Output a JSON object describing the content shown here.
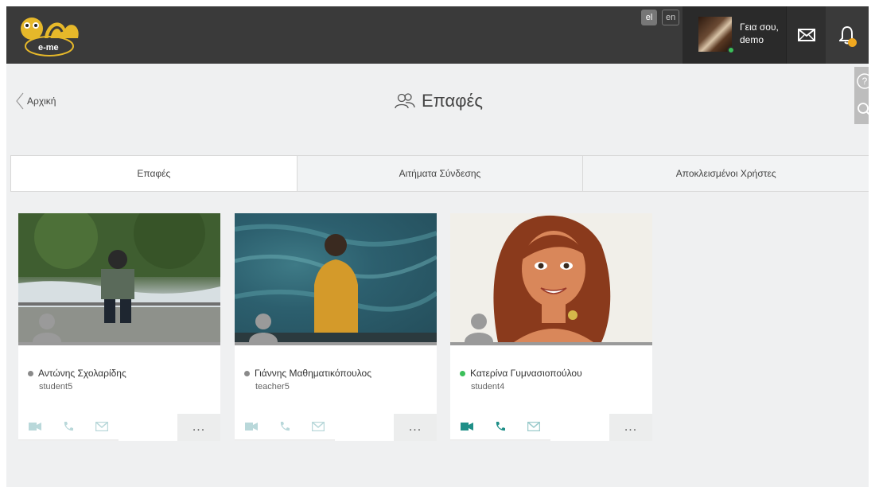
{
  "app": {
    "logo_text": "e-me",
    "languages": [
      {
        "code": "el",
        "active": true
      },
      {
        "code": "en",
        "active": false
      }
    ],
    "user": {
      "greeting": "Γεια σου,",
      "name": "demo",
      "online": true
    },
    "notifications": {
      "badge_color": "#f0a820"
    },
    "colors": {
      "accent_teal": "#2a9d8f",
      "online": "#3bbf5a",
      "offline": "#8a8a8a",
      "topbar": "#3a3a3a"
    }
  },
  "header": {
    "back_label": "Αρχική",
    "title": "Επαφές",
    "title_icon": "contacts-icon"
  },
  "side_tools": [
    {
      "icon": "help-icon"
    },
    {
      "icon": "search-icon"
    }
  ],
  "tabs": [
    {
      "label": "Επαφές",
      "active": true
    },
    {
      "label": "Αιτήματα Σύνδεσης",
      "active": false
    },
    {
      "label": "Αποκλεισμένοι Χρήστες",
      "active": false
    }
  ],
  "contacts": [
    {
      "name": "Αντώνης Σχολαρίδης",
      "username": "student5",
      "status": "offline",
      "photo": "man-on-railing-by-river"
    },
    {
      "name": "Γιάννης Μαθηματικόπουλος",
      "username": "teacher5",
      "status": "offline",
      "photo": "man-in-yellow-jacket-by-sea"
    },
    {
      "name": "Κατερίνα Γυμνασιοπούλου",
      "username": "student4",
      "status": "online",
      "photo": "cartoon-woman-avatar"
    }
  ],
  "card_actions": {
    "icons": [
      "video-call-icon",
      "phone-call-icon",
      "message-icon"
    ],
    "more_label": "..."
  }
}
